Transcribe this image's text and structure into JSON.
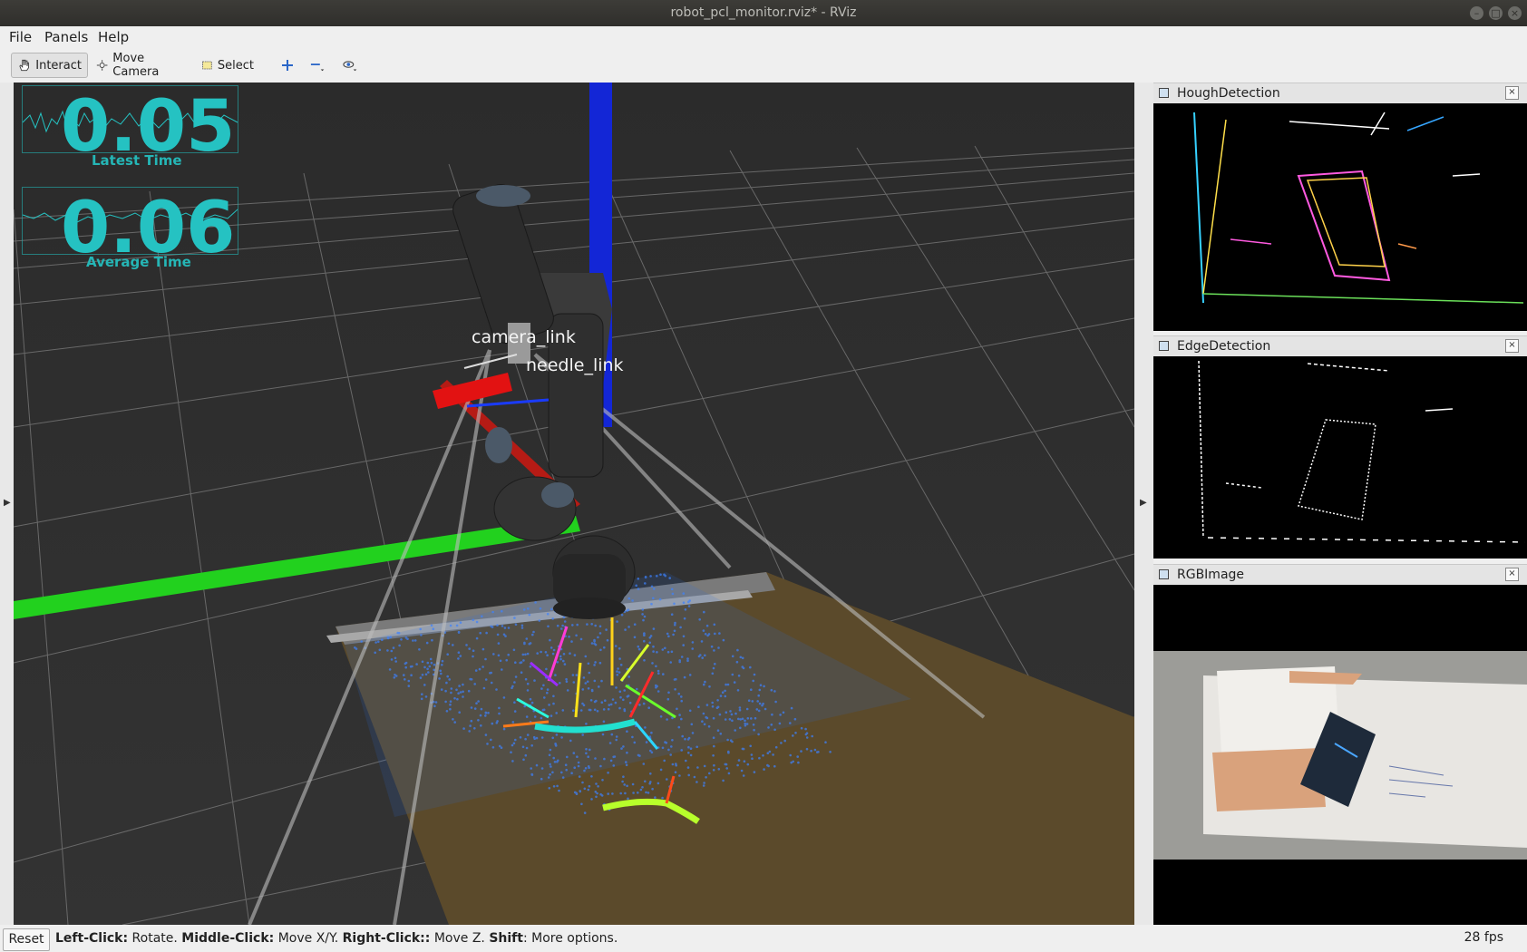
{
  "window": {
    "title": "robot_pcl_monitor.rviz* - RViz"
  },
  "menu": {
    "file": "File",
    "panels": "Panels",
    "help": "Help"
  },
  "toolbar": {
    "interact": "Interact",
    "move_camera": "Move Camera",
    "select": "Select"
  },
  "overlay": {
    "latest_value": "0.05",
    "latest_label": "Latest Time",
    "average_value": "0.06",
    "average_label": "Average Time",
    "color": "#25c2c2"
  },
  "scene": {
    "frame_labels": [
      "camera_link",
      "needle_link"
    ],
    "background": "#2e2e2e"
  },
  "panels": [
    {
      "title": "HoughDetection"
    },
    {
      "title": "EdgeDetection"
    },
    {
      "title": "RGBImage"
    }
  ],
  "status": {
    "reset": "Reset",
    "hint_parts": [
      {
        "b": "Left-Click:",
        "t": " Rotate. "
      },
      {
        "b": "Middle-Click:",
        "t": " Move X/Y. "
      },
      {
        "b": "Right-Click::",
        "t": " Move Z. "
      },
      {
        "b": "Shift",
        "t": ": More options."
      }
    ],
    "fps": "28 fps"
  }
}
